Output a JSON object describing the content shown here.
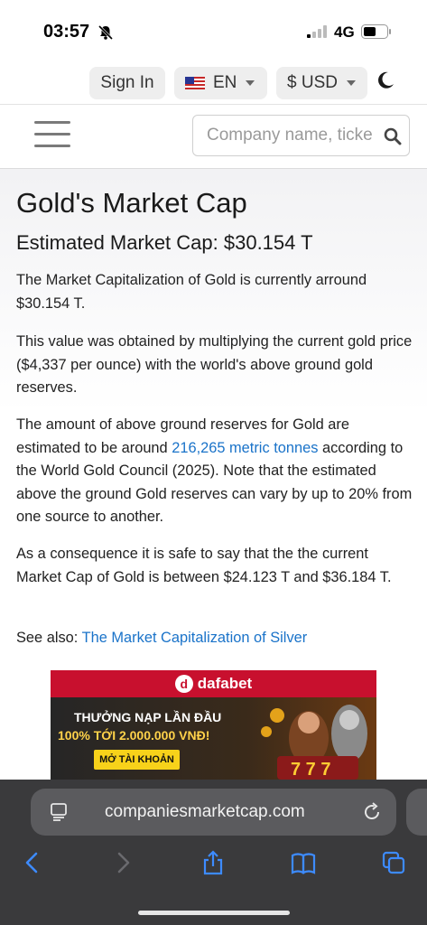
{
  "status_bar": {
    "time": "03:57",
    "network": "4G"
  },
  "topbar": {
    "sign_in_label": "Sign In",
    "language_label": "EN",
    "currency_label": "$ USD"
  },
  "search": {
    "placeholder": "Company name, ticker"
  },
  "main": {
    "title": "Gold's Market Cap",
    "subtitle": "Estimated Market Cap: $30.154 T",
    "p1": "The Market Capitalization of Gold is currently arround $30.154 T.",
    "p2": "This value was obtained by multiplying the current gold price ($4,337 per ounce) with the world's above ground gold reserves.",
    "p3_before": "The amount of above ground reserves for Gold are estimated to be around ",
    "p3_link": "216,265 metric tonnes",
    "p3_after": " according to the World Gold Council (2025). Note that the estimated above the ground Gold reserves can vary by up to 20% from one source to another.",
    "p4": "As a consequence it is safe to say that the the current Market Cap of Gold is between $24.123 T and $36.184 T.",
    "see_also_prefix": "See also: ",
    "see_also_link": "The Market Capitalization of Silver"
  },
  "ad": {
    "brand": "dafabet",
    "line1": "THƯỞNG NẠP LẦN ĐẦU",
    "line2": "100% TỚI 2.000.000 VNĐ!",
    "cta": "MỞ TÀI KHOẢN"
  },
  "browser": {
    "url": "companiesmarketcap.com"
  },
  "colors": {
    "link": "#1a73c9",
    "browser_bg": "#3a3a3c",
    "toolbar_icon": "#3d8bff"
  }
}
